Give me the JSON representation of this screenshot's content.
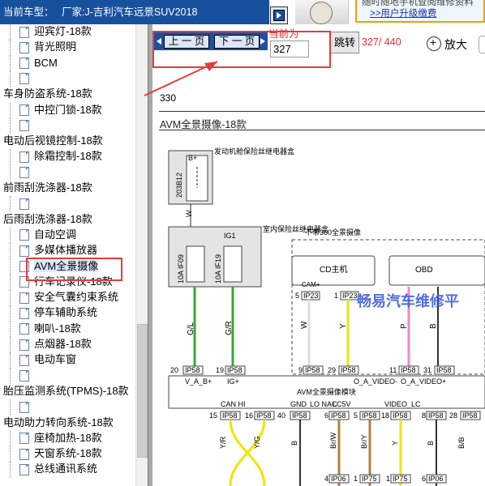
{
  "header": {
    "vehicle_label": "当前车型：",
    "vehicle_value": "厂家:J-吉利汽车远景SUV2018"
  },
  "ad": {
    "line1": "随时随地手机查阅维修资料",
    "line2": ">>用户升级缴费"
  },
  "tree": [
    {
      "type": "leaf",
      "label": "迎宾灯-18款"
    },
    {
      "type": "leaf",
      "label": "背光照明"
    },
    {
      "type": "leaf",
      "label": "BCM"
    },
    {
      "type": "leaf",
      "label": ""
    },
    {
      "type": "cat",
      "label": "车身防盗系统-18款"
    },
    {
      "type": "leaf",
      "label": "中控门锁-18款"
    },
    {
      "type": "leaf",
      "label": ""
    },
    {
      "type": "cat",
      "label": "电动后视镜控制-18款"
    },
    {
      "type": "leaf",
      "label": "除霜控制-18款"
    },
    {
      "type": "leaf",
      "label": ""
    },
    {
      "type": "cat",
      "label": "前雨刮洗涤器-18款"
    },
    {
      "type": "leaf",
      "label": ""
    },
    {
      "type": "cat",
      "label": "后雨刮洗涤器-18款"
    },
    {
      "type": "leaf",
      "label": "自动空调"
    },
    {
      "type": "leaf",
      "label": "多媒体播放器"
    },
    {
      "type": "leaf",
      "label": "AVM全景摄像",
      "selected": true
    },
    {
      "type": "leaf",
      "label": "行车记录仪-18款"
    },
    {
      "type": "leaf",
      "label": "安全气囊约束系统"
    },
    {
      "type": "leaf",
      "label": "停车辅助系统"
    },
    {
      "type": "leaf",
      "label": "喇叭-18款"
    },
    {
      "type": "leaf",
      "label": "点烟器-18款"
    },
    {
      "type": "leaf",
      "label": "电动车窗"
    },
    {
      "type": "leaf",
      "label": ""
    },
    {
      "type": "cat",
      "label": "胎压监测系统(TPMS)-18款"
    },
    {
      "type": "leaf",
      "label": ""
    },
    {
      "type": "cat",
      "label": "电动助力转向系统-18款"
    },
    {
      "type": "leaf",
      "label": "座椅加热-18款"
    },
    {
      "type": "leaf",
      "label": "天窗系统-18款"
    },
    {
      "type": "leaf",
      "label": "总线通讯系统"
    }
  ],
  "toolbar": {
    "prev_label": "上 一 页",
    "next_label": "下 一 页",
    "current_label": "当前为",
    "page_value": "327",
    "go_label": "跳转",
    "page_count": "327/ 440",
    "zoom_label": "放大"
  },
  "diagram": {
    "page_number": "330",
    "title": "AVM全景摄像-18款",
    "relay_box": "发动机舱保险丝继电器盒",
    "relay_b_plus": "B+",
    "relay_code": "203B12",
    "wire_w": "W",
    "fuse_box": "室内保险丝继电器盒",
    "ig1": "IG1",
    "fuse1": "10A IF09",
    "fuse2": "10A IF19",
    "note_360": "不带360全景摄像",
    "cd_host": "CD主机",
    "cam_plus": "CAM+",
    "obd": "OBD",
    "wire_gl": "G/L",
    "wire_gr": "G/R",
    "wire_y": "Y",
    "wire_p": "P",
    "wire_b": "B",
    "module_label": "AVM全景摄像模块",
    "pin_labels": [
      "V_A_B+",
      "IG+",
      "O_A_VIDEO-",
      "O_A_VIDEO+"
    ],
    "bottom_labels": [
      "CAN HI",
      "CAN LO",
      "GND",
      "LO NAC",
      "LC5V",
      "VIDEO_LC"
    ],
    "connectors_top": [
      "5",
      "IP23",
      "1",
      "IP23",
      "6",
      "IP58",
      "10",
      "IP58"
    ],
    "connectors_mod": [
      "20",
      "IP58",
      "19",
      "IP58",
      "9",
      "IP58",
      "29",
      "IP58",
      "11",
      "IP58",
      "31",
      "IP58"
    ],
    "connectors_bot": [
      "15",
      "IP58",
      "16",
      "IP58",
      "40",
      "IP58",
      "6",
      "IP58",
      "5",
      "IP58",
      "18",
      "IP58",
      "8",
      "IP58",
      "28",
      "IP58"
    ],
    "wires_bot": [
      "Y/R",
      "Y/G",
      "B",
      "Br/W",
      "Br/Y",
      "Y",
      "B",
      "B/B"
    ],
    "connectors_low": [
      "4",
      "IP06",
      "1",
      "IP75",
      "1",
      "IP75",
      "6",
      "IP06"
    ],
    "watermark": "畅易汽车维修平"
  }
}
